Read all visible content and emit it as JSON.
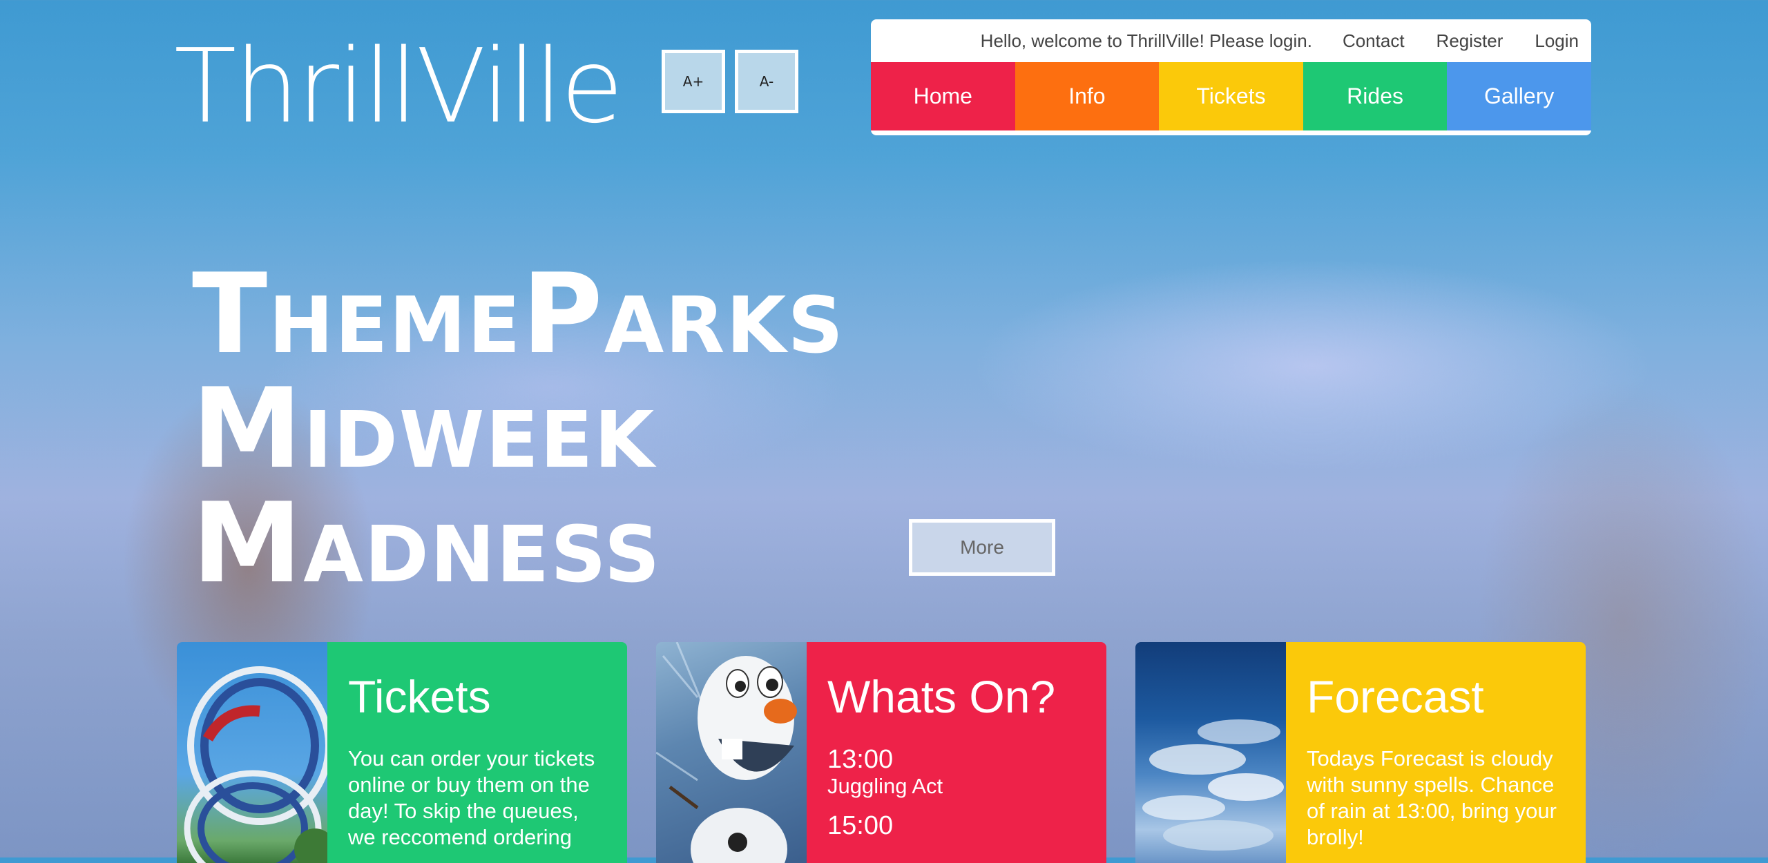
{
  "header": {
    "logo": "ThrillVille",
    "font_increase": "A+",
    "font_decrease": "A-"
  },
  "topbar": {
    "greeting": "Hello, welcome to ThrillVille! Please login.",
    "links": [
      "Contact",
      "Register",
      "Login"
    ]
  },
  "nav": {
    "items": [
      {
        "label": "Home",
        "color": "#ee2249"
      },
      {
        "label": "Info",
        "color": "#fd6f10"
      },
      {
        "label": "Tickets",
        "color": "#fbc90a"
      },
      {
        "label": "Rides",
        "color": "#1ec874"
      },
      {
        "label": "Gallery",
        "color": "#4c97ec"
      }
    ]
  },
  "hero": {
    "lines": [
      "ThemeParks",
      "Midweek",
      "Madness"
    ],
    "button": "More"
  },
  "cards": {
    "tickets": {
      "title": "Tickets",
      "text": "You can order your tickets online or buy them on the day! To skip the queues, we reccomend ordering",
      "image_icon": "rollercoaster-image",
      "color": "#1ec874"
    },
    "whatson": {
      "title": "Whats On?",
      "events": [
        {
          "time": "13:00",
          "act": "Juggling Act"
        },
        {
          "time": "15:00",
          "act": ""
        }
      ],
      "image_icon": "snowman-image",
      "color": "#ee2249"
    },
    "forecast": {
      "title": "Forecast",
      "text": "Todays Forecast is cloudy with sunny spells. Chance of rain at 13:00, bring your brolly!",
      "image_icon": "cloudy-sky-image",
      "color": "#fbc90a"
    }
  }
}
